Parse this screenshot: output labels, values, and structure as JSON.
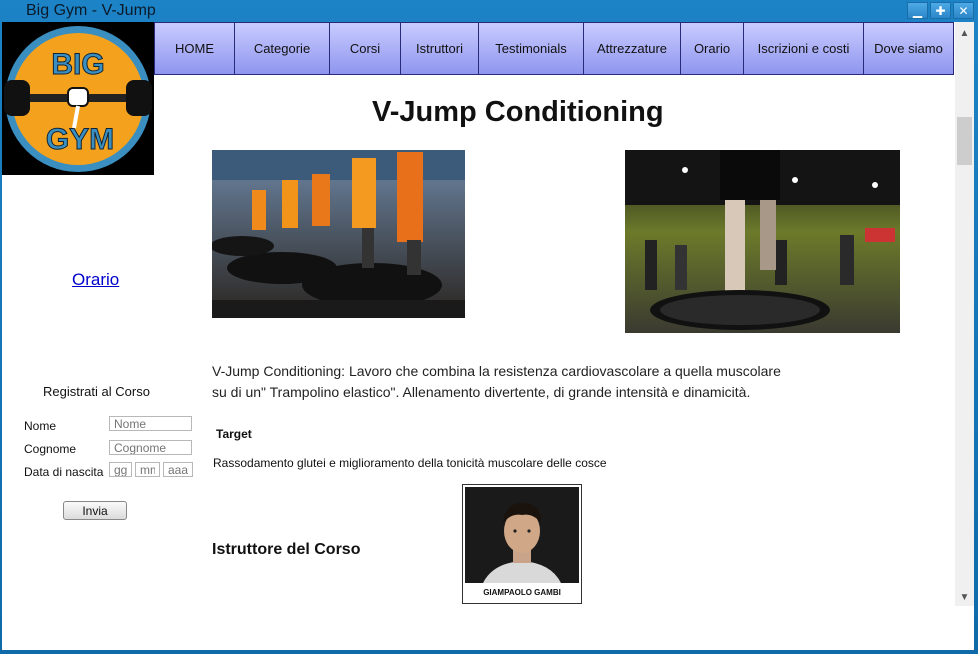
{
  "window": {
    "title": "Big Gym - V-Jump",
    "controls": [
      "minimize",
      "maximize",
      "close"
    ]
  },
  "logo": {
    "text_top": "BIG",
    "text_bottom": "GYM"
  },
  "nav": {
    "items": [
      {
        "label": "HOME",
        "width": 81
      },
      {
        "label": "Categorie",
        "width": 95
      },
      {
        "label": "Corsi",
        "width": 71
      },
      {
        "label": "Istruttori",
        "width": 78
      },
      {
        "label": "Testimonials",
        "width": 105
      },
      {
        "label": "Attrezzature",
        "width": 97
      },
      {
        "label": "Orario",
        "width": 63
      },
      {
        "label": "Iscrizioni e costi",
        "width": 120
      },
      {
        "label": "Dove siamo",
        "width": 90
      }
    ]
  },
  "sidebar": {
    "orario_link": "Orario",
    "form": {
      "title": "Registrati al Corso",
      "nome_label": "Nome",
      "nome_placeholder": "Nome",
      "cognome_label": "Cognome",
      "cognome_placeholder": "Cognome",
      "data_label": "Data di nascita",
      "gg_placeholder": "gg",
      "mm_placeholder": "mm",
      "aaaa_placeholder": "aaaa",
      "submit_label": "Invia"
    }
  },
  "main": {
    "heading": "V-Jump Conditioning",
    "description_line1": "V-Jump Conditioning: Lavoro che combina la resistenza cardiovascolare a quella muscolare",
    "description_line2": "su di un\" Trampolino elastico\". Allenamento divertente, di grande intensità e dinamicità.",
    "target_label": "Target",
    "target_text": "Rassodamento glutei e miglioramento della tonicità muscolare delle cosce",
    "instructor_heading": "Istruttore del Corso",
    "instructor_name": "GIAMPAOLO GAMBI"
  },
  "colors": {
    "nav_bg": "#aab0f8",
    "titlebar": "#1c83c6",
    "link": "#0000cc",
    "logo_orange": "#f4a21e",
    "logo_blue": "#3a8fc0"
  }
}
